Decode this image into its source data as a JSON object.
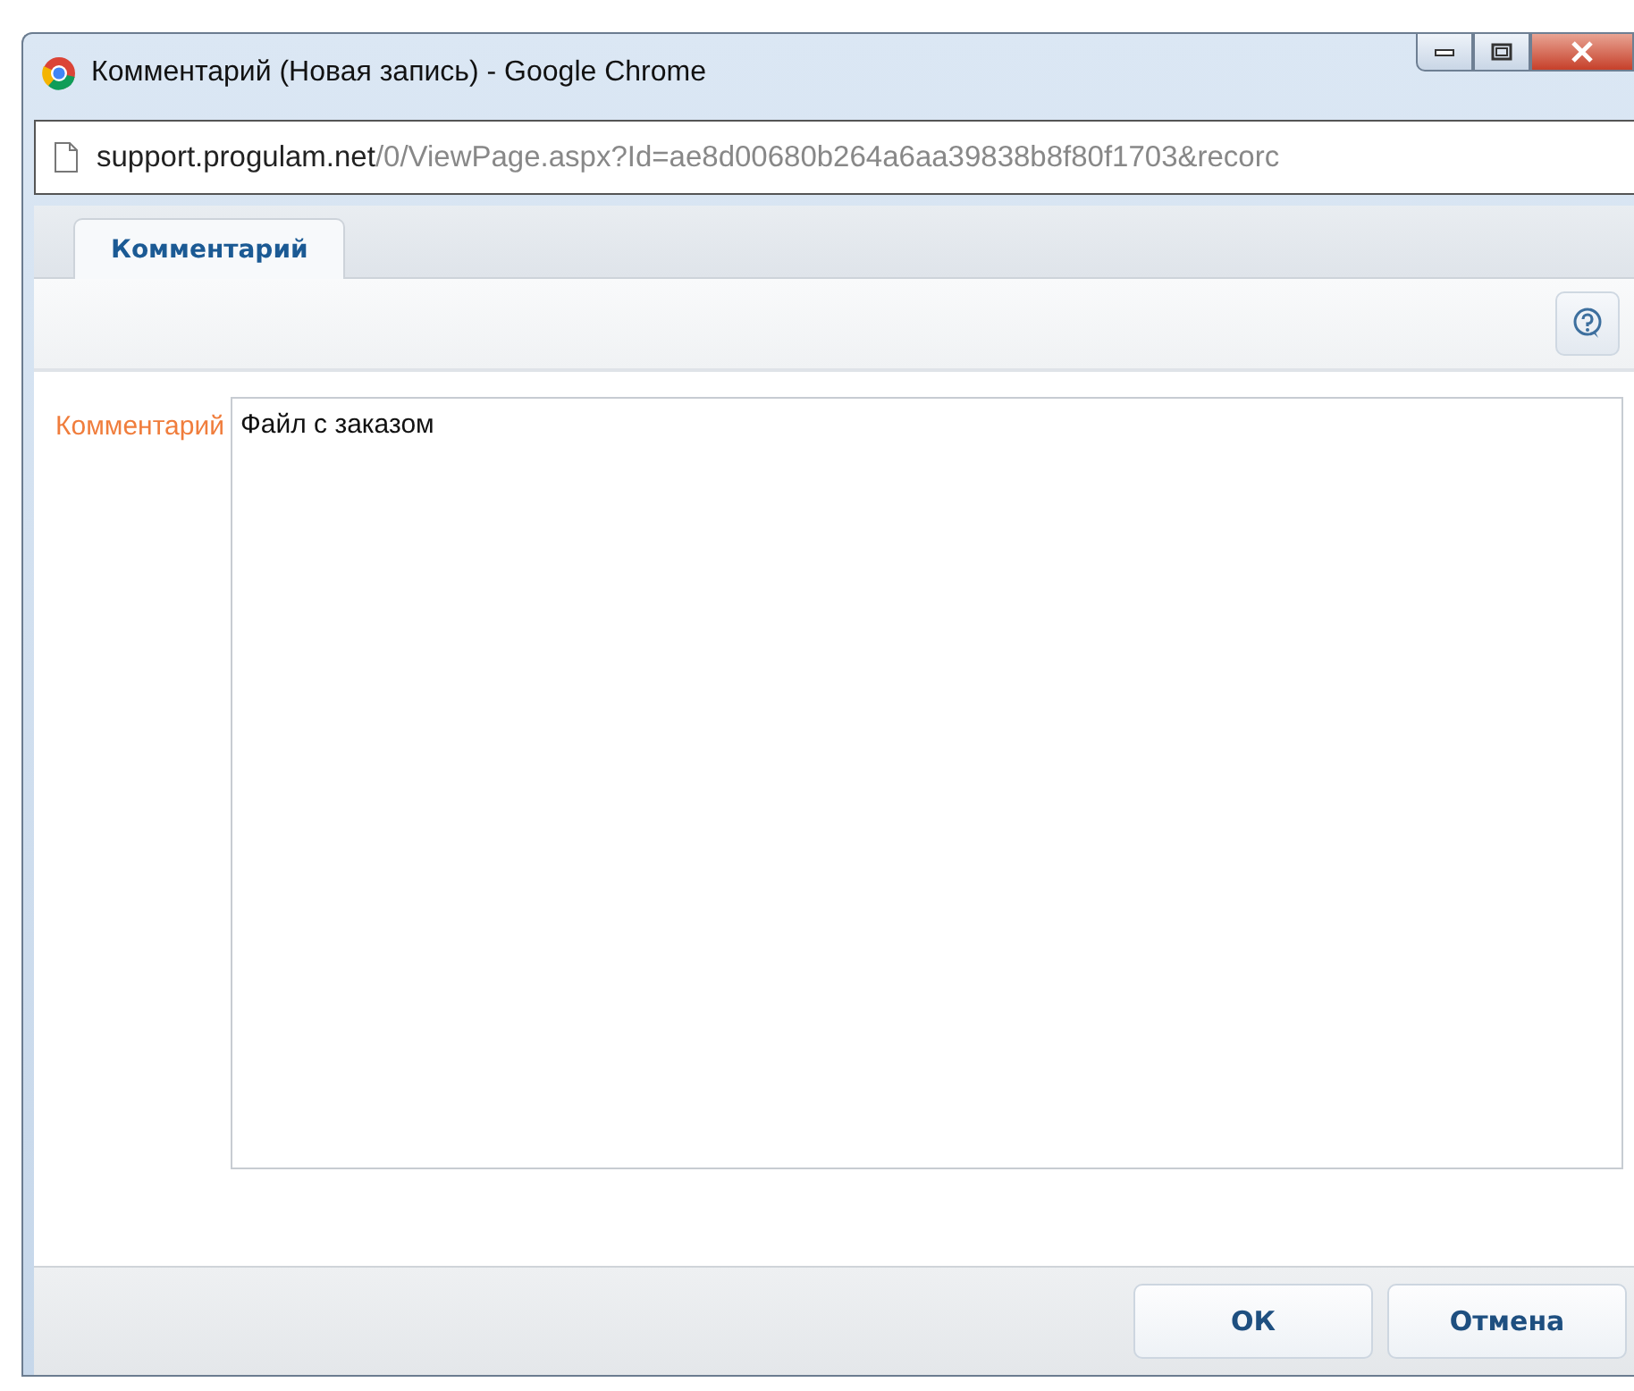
{
  "window": {
    "title": "Комментарий (Новая запись) - Google Chrome"
  },
  "address": {
    "host": "support.progulam.net",
    "path": "/0/ViewPage.aspx?Id=ae8d00680b264a6aa39838b8f80f1703&recorc"
  },
  "tabs": [
    {
      "label": "Комментарий",
      "selected": true
    }
  ],
  "form": {
    "label": "Комментарий",
    "value": "Файл с заказом"
  },
  "buttons": [
    {
      "label": "ОК"
    },
    {
      "label": "Отмена"
    }
  ]
}
